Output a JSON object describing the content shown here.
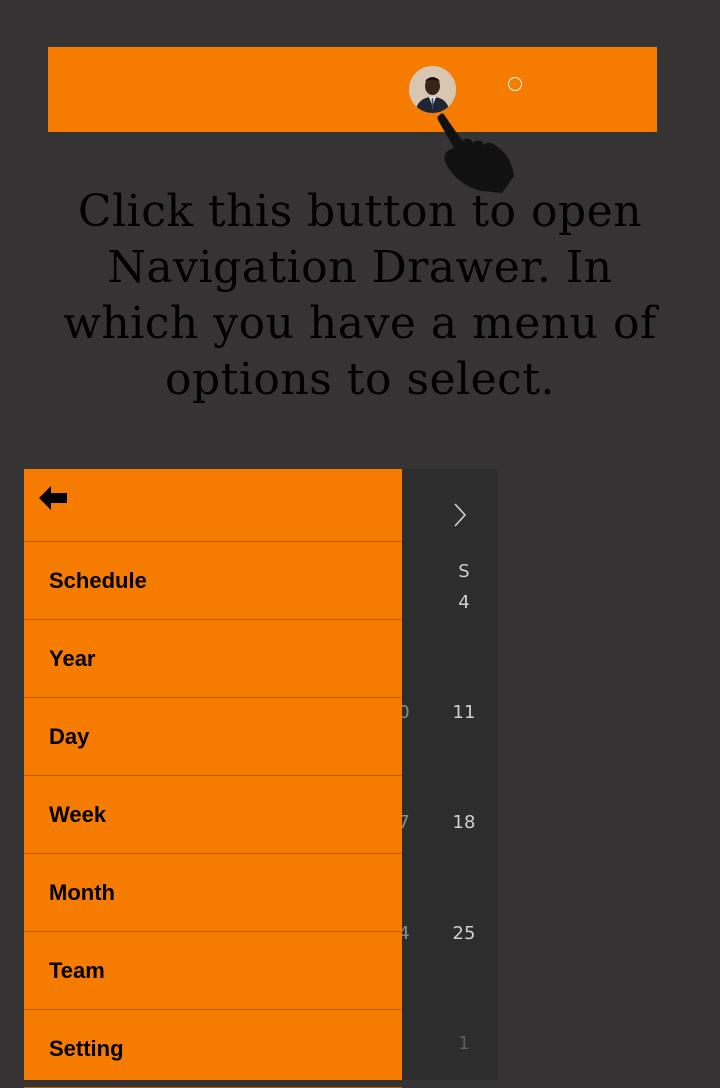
{
  "instruction_text": "Click this button to open Navigation Drawer. In which you have a menu of options to select.",
  "calendar": {
    "day_header": "S",
    "dates": [
      "4",
      "11",
      "18",
      "25",
      "1"
    ],
    "partial_dates": [
      "0",
      "7",
      "4"
    ]
  },
  "drawer": {
    "back_icon": "back-arrow-icon",
    "items": [
      {
        "label": "Schedule"
      },
      {
        "label": "Year"
      },
      {
        "label": "Day"
      },
      {
        "label": "Week"
      },
      {
        "label": "Month"
      },
      {
        "label": "Team"
      },
      {
        "label": "Setting"
      }
    ]
  },
  "colors": {
    "accent": "#F57C00",
    "background": "#363334",
    "calendar_background": "#2d2d2d"
  }
}
